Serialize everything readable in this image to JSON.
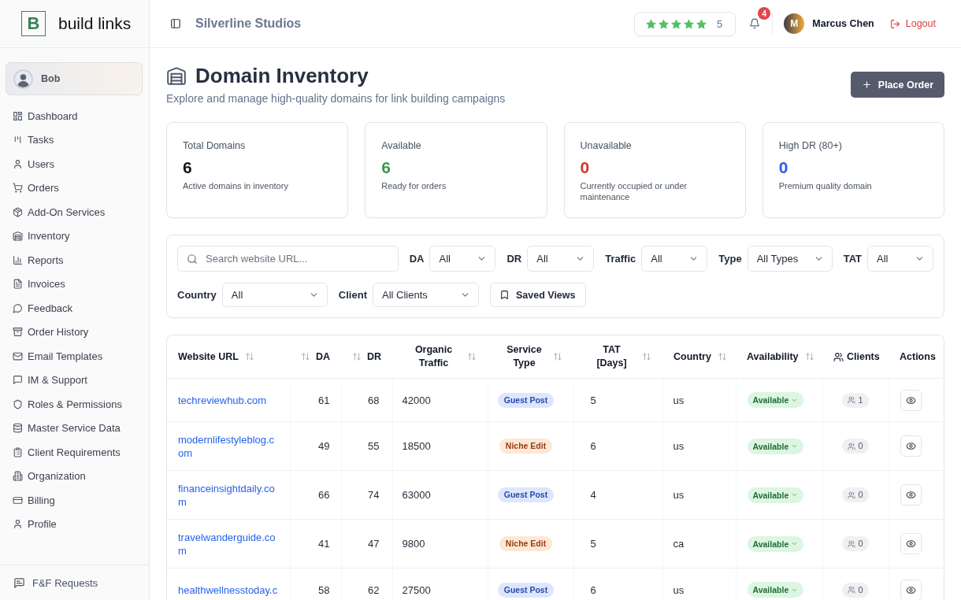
{
  "sidebar": {
    "logo": {
      "mark": "B",
      "name": "build links"
    },
    "profile": {
      "name": "Bob"
    },
    "items": [
      {
        "label": "Dashboard"
      },
      {
        "label": "Tasks"
      },
      {
        "label": "Users"
      },
      {
        "label": "Orders"
      },
      {
        "label": "Add-On Services"
      },
      {
        "label": "Inventory"
      },
      {
        "label": "Reports"
      },
      {
        "label": "Invoices"
      },
      {
        "label": "Feedback"
      },
      {
        "label": "Order History"
      },
      {
        "label": "Email Templates"
      },
      {
        "label": "IM & Support"
      },
      {
        "label": "Roles & Permissions"
      },
      {
        "label": "Master Service Data"
      },
      {
        "label": "Client Requirements"
      },
      {
        "label": "Organization"
      },
      {
        "label": "Billing"
      },
      {
        "label": "Profile"
      }
    ],
    "footer_items": [
      {
        "label": "F&F Requests"
      }
    ]
  },
  "header": {
    "workspace": "Silverline Studios",
    "rating": {
      "stars": 5,
      "value": "5"
    },
    "notifications": {
      "count": "4"
    },
    "user": {
      "initial": "M",
      "name": "Marcus Chen"
    },
    "logout": "Logout"
  },
  "page": {
    "title": "Domain Inventory",
    "subtitle": "Explore and manage high-quality domains for link building campaigns",
    "action": "Place Order"
  },
  "stats": [
    {
      "label": "Total Domains",
      "value": "6",
      "note": "Active domains in inventory",
      "color": "#161616"
    },
    {
      "label": "Available",
      "value": "6",
      "note": "Ready for orders",
      "color": "#3c9a4c"
    },
    {
      "label": "Unavailable",
      "value": "0",
      "note": "Currently occupied or under maintenance",
      "color": "#cc3a2c"
    },
    {
      "label": "High DR (80+)",
      "value": "0",
      "note": "Premium quality domain",
      "color": "#2d5ce8"
    }
  ],
  "filters": {
    "search": {
      "placeholder": "Search website URL..."
    },
    "selects": [
      {
        "label": "DA",
        "value": "All"
      },
      {
        "label": "DR",
        "value": "All"
      },
      {
        "label": "Traffic",
        "value": "All"
      },
      {
        "label": "Type",
        "value": "All Types"
      },
      {
        "label": "TAT",
        "value": "All"
      },
      {
        "label": "Country",
        "value": "All"
      },
      {
        "label": "Client",
        "value": "All Clients"
      }
    ],
    "saved_views": "Saved Views"
  },
  "table": {
    "columns": [
      {
        "label": "Website URL",
        "sortable": true
      },
      {
        "label": "DA",
        "sortable": true
      },
      {
        "label": "DR",
        "sortable": true
      },
      {
        "label": "Organic Traffic",
        "sortable": true
      },
      {
        "label": "Service Type",
        "sortable": true
      },
      {
        "label": "TAT [Days]",
        "sortable": true
      },
      {
        "label": "Country",
        "sortable": true
      },
      {
        "label": "Availability",
        "sortable": true
      },
      {
        "label": "Clients",
        "sortable": false
      },
      {
        "label": "Actions",
        "sortable": false
      }
    ],
    "rows": [
      {
        "url": "techreviewhub.com",
        "da": "61",
        "dr": "68",
        "traffic": "42000",
        "service": {
          "label": "Guest Post",
          "kind": "guest"
        },
        "tat": "5",
        "country": "us",
        "availability": "Available",
        "clients": "1"
      },
      {
        "url": "modernlifestyleblog.com",
        "da": "49",
        "dr": "55",
        "traffic": "18500",
        "service": {
          "label": "Niche Edit",
          "kind": "niche"
        },
        "tat": "6",
        "country": "us",
        "availability": "Available",
        "clients": "0"
      },
      {
        "url": "financeinsightdaily.com",
        "da": "66",
        "dr": "74",
        "traffic": "63000",
        "service": {
          "label": "Guest Post",
          "kind": "guest"
        },
        "tat": "4",
        "country": "us",
        "availability": "Available",
        "clients": "0"
      },
      {
        "url": "travelwanderguide.com",
        "da": "41",
        "dr": "47",
        "traffic": "9800",
        "service": {
          "label": "Niche Edit",
          "kind": "niche"
        },
        "tat": "5",
        "country": "ca",
        "availability": "Available",
        "clients": "0"
      },
      {
        "url": "healthwellnesstoday.c",
        "da": "58",
        "dr": "62",
        "traffic": "27500",
        "service": {
          "label": "Guest Post",
          "kind": "guest"
        },
        "tat": "6",
        "country": "us",
        "availability": "Available",
        "clients": "0"
      }
    ]
  }
}
